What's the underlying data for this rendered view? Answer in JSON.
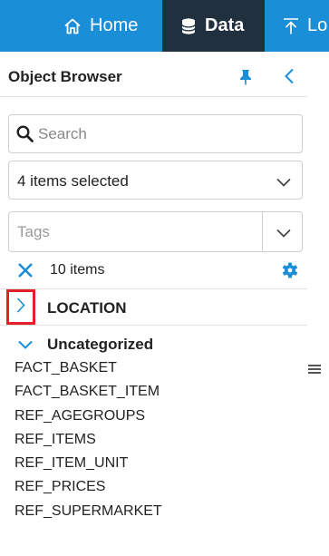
{
  "nav": {
    "tabs": [
      {
        "label": "Home",
        "icon": "home-icon"
      },
      {
        "label": "Data",
        "icon": "database-icon",
        "active": true
      },
      {
        "label": "Lo",
        "icon": "upload-icon"
      }
    ],
    "colors": {
      "bar": "#1a8fd8",
      "active": "#21303f"
    }
  },
  "panel": {
    "title": "Object Browser",
    "search": {
      "placeholder": "Search",
      "value": ""
    },
    "selection": {
      "value": "4 items selected"
    },
    "tags": {
      "placeholder": "Tags"
    },
    "count_text": "10 items",
    "groups": [
      {
        "label": "LOCATION",
        "expanded": false
      },
      {
        "label": "Uncategorized",
        "expanded": true,
        "items": [
          "FACT_BASKET",
          "FACT_BASKET_ITEM",
          "REF_AGEGROUPS",
          "REF_ITEMS",
          "REF_ITEM_UNIT",
          "REF_PRICES",
          "REF_SUPERMARKET"
        ]
      }
    ],
    "accent_color": "#1a8fd8",
    "highlight_color": "#e3202a"
  }
}
